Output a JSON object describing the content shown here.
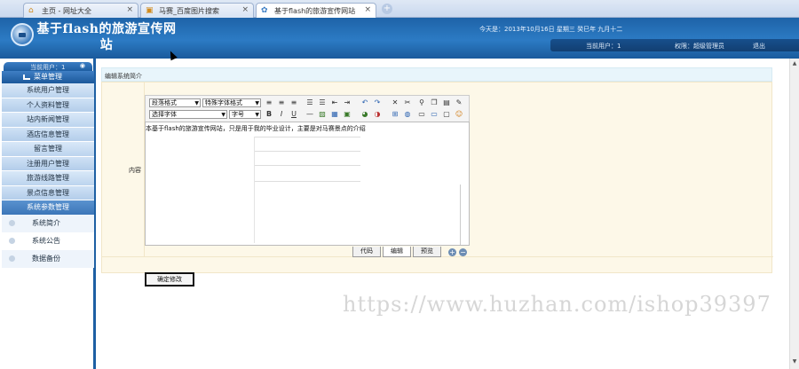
{
  "browser": {
    "tabs": [
      {
        "label": "主页 - 网址大全",
        "icon": "home-icon"
      },
      {
        "label": "马赛_百度图片搜索",
        "icon": "image-icon"
      },
      {
        "label": "基于flash的旅游宣传网站",
        "icon": "page-icon"
      }
    ],
    "close_glyph": "×",
    "new_tab_glyph": "+"
  },
  "header": {
    "title": "基于flash的旅游宣传网站",
    "date": "今天是：2013年10月16日 星期三 癸巳年 九月十二",
    "current_user": "当前用户：1",
    "role": "权限：超级管理员",
    "logout": "退出"
  },
  "sidebar": {
    "current_user": "当前用户：1",
    "head": "菜单管理",
    "items": [
      "系统用户管理",
      "个人资料管理",
      "站内新闻管理",
      "酒店信息管理",
      "留言管理",
      "注册用户管理",
      "旅游线路管理",
      "景点信息管理",
      "系统参数管理"
    ],
    "sub_items": [
      "系统简介",
      "系统公告",
      "数据备份"
    ]
  },
  "content": {
    "breadcrumb": "编辑系统简介",
    "field_label": "内容",
    "editor": {
      "paragraph_format": "段落格式",
      "font_style": "特殊字体格式",
      "font_name": "选择字体",
      "font_size": "字号",
      "text": "本基于flash的旅游宣传网站，只是用于我的毕业设计，主要是对马赛景点的介绍",
      "modes": [
        "代码",
        "编辑",
        "预览"
      ]
    },
    "submit": "确定修改"
  },
  "watermark": "https://www.huzhan.com/ishop39397",
  "colors": {
    "primary": "#1d5fa3",
    "header": "#2c7bc4",
    "form_bg": "#fdf8e8"
  }
}
